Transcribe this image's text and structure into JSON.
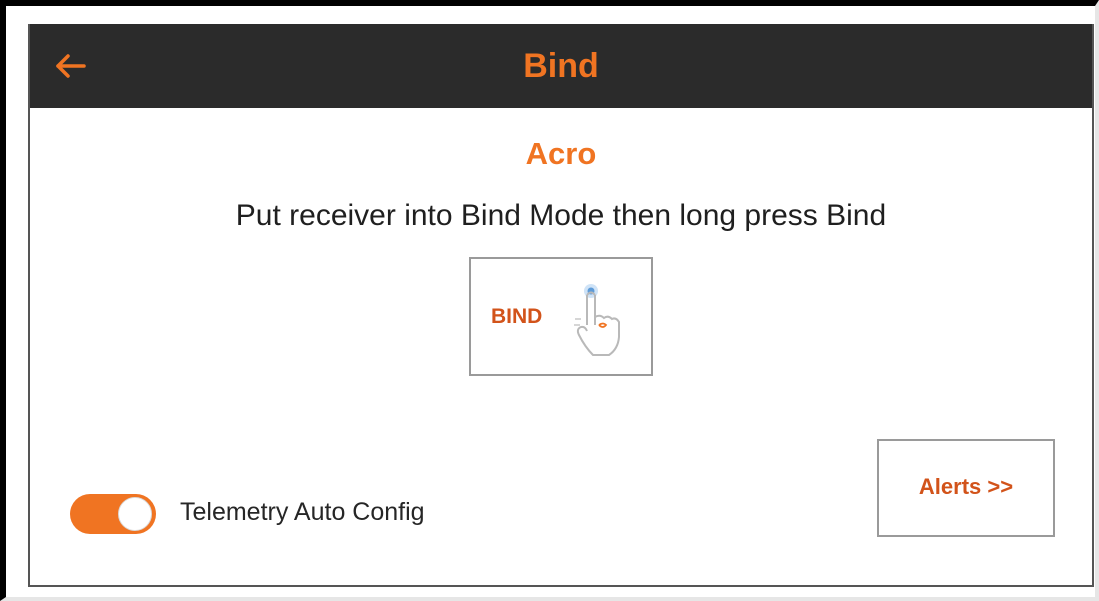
{
  "header": {
    "title": "Bind",
    "back_icon": "arrow-left-icon"
  },
  "model": {
    "name": "Acro"
  },
  "instruction": "Put receiver into Bind Mode then long press Bind",
  "bind_button": {
    "label": "BIND",
    "icon": "finger-press-icon"
  },
  "telemetry": {
    "label": "Telemetry Auto Config",
    "enabled": true
  },
  "alerts_button": {
    "label": "Alerts >>"
  },
  "colors": {
    "accent": "#f07422",
    "header_bg": "#2b2b2b",
    "button_text": "#d2531a"
  }
}
